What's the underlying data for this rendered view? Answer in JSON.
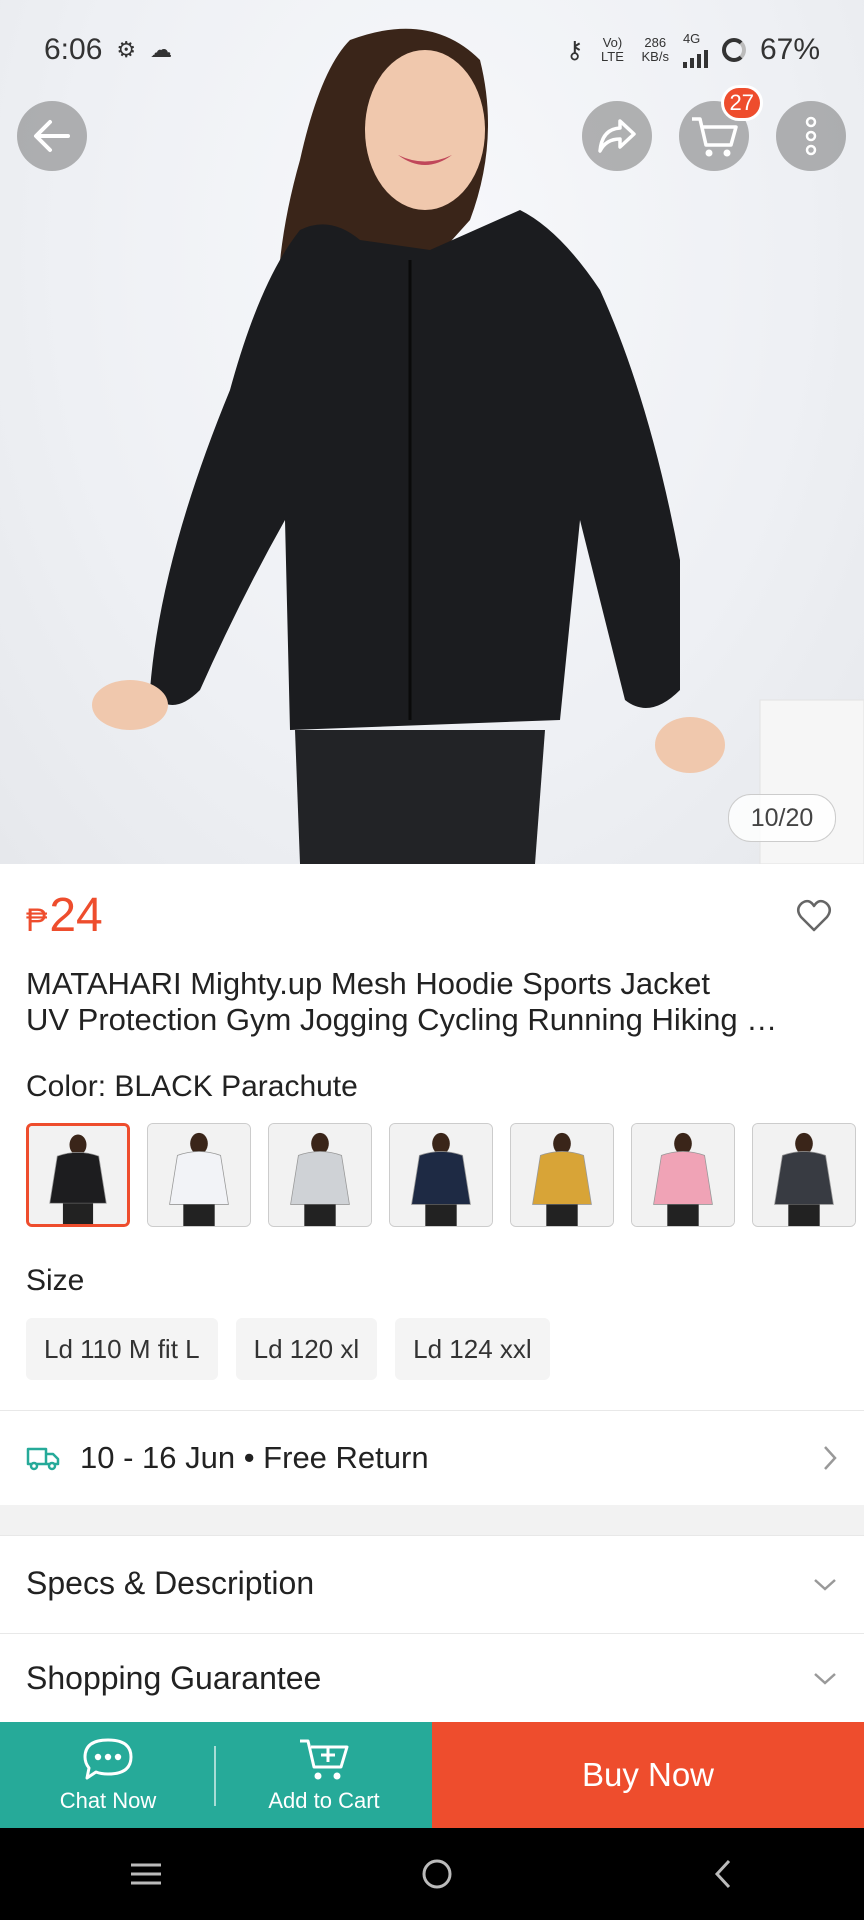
{
  "status_bar": {
    "time": "6:06",
    "volte": "Vo) LTE",
    "speed_value": "286",
    "speed_unit": "KB/s",
    "network": "4G",
    "battery": "67%"
  },
  "header": {
    "cart_count": "27"
  },
  "gallery": {
    "counter": "10/20"
  },
  "product": {
    "currency": "₱",
    "price": "24",
    "title_line1": "MATAHARI Mighty.up Mesh Hoodie Sports Jacket",
    "title_line2": "UV Protection Gym Jogging Cycling Running Hiking …",
    "color_label": "Color: BLACK Parachute",
    "swatch_colors": [
      "#1d1d1f",
      "#f2f3f7",
      "#cfd2d6",
      "#1e2a44",
      "#d8a437",
      "#f0a3b6",
      "#383b42"
    ],
    "size_label": "Size",
    "sizes": [
      "Ld 110 M fit L",
      "Ld 120 xl",
      "Ld 124 xxl"
    ]
  },
  "delivery": {
    "text": "10 - 16 Jun • Free Return"
  },
  "sections": {
    "specs": "Specs & Description",
    "guarantee": "Shopping Guarantee"
  },
  "actions": {
    "chat": "Chat Now",
    "add_to_cart": "Add to Cart",
    "buy_now": "Buy Now"
  },
  "colors": {
    "accent": "#ee4d2d",
    "teal": "#26aa99"
  }
}
